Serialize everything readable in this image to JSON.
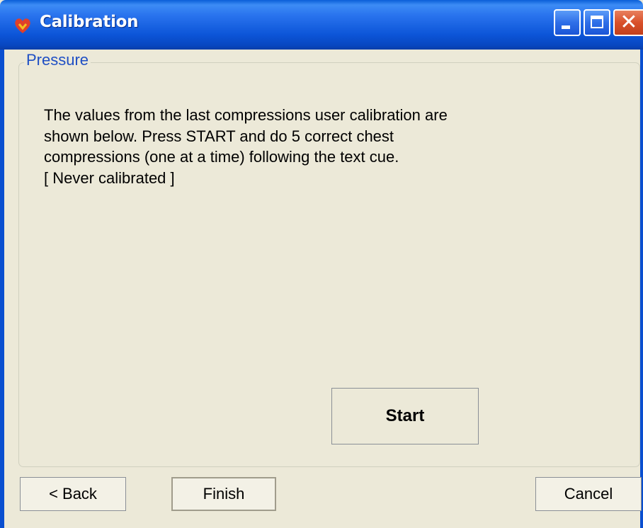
{
  "window": {
    "title": "Calibration",
    "icon": "heart-icon",
    "controls": [
      "minimize",
      "maximize",
      "close"
    ],
    "close_glyph": "✕"
  },
  "group": {
    "legend": "Pressure",
    "instruction_lines": [
      "The values from the last compressions user calibration are",
      "shown below.  Press START and do 5 correct chest",
      "compressions (one at a time) following the text cue.",
      "[ Never calibrated ]"
    ],
    "start_label": "Start"
  },
  "footer": {
    "back_label": "< Back",
    "finish_label": "Finish",
    "cancel_label": "Cancel"
  },
  "colors": {
    "title_bar": "#0c55d8",
    "dialog_background": "#ece9d8",
    "legend_text": "#1f4fc4",
    "close_button": "#d9502a"
  }
}
